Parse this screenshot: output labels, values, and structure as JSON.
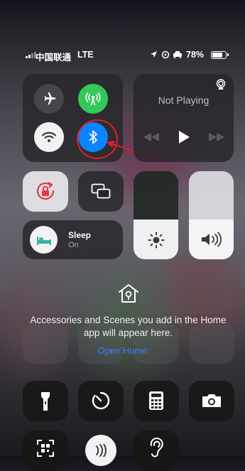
{
  "status_bar": {
    "carrier": "中国联通",
    "network": "LTE",
    "battery": "78%"
  },
  "connectivity": {
    "airplane": {
      "on": false
    },
    "cellular": {
      "on": true
    },
    "wifi": {
      "on": true
    },
    "bluetooth": {
      "on": true
    }
  },
  "media": {
    "title": "Not Playing"
  },
  "focus": {
    "label": "Sleep",
    "state": "On"
  },
  "brightness": {
    "level": 0.45
  },
  "volume": {
    "level": 0.45
  },
  "home": {
    "message": "Accessories and Scenes you add in the Home app will appear here.",
    "link": "Open Home"
  },
  "colors": {
    "cellular_green": "#34c759",
    "bluetooth_blue": "#0a84ff",
    "annotation_red": "#e02020",
    "link_blue": "#3d7bff"
  },
  "icons": [
    "airplane-icon",
    "cellular-icon",
    "wifi-icon",
    "bluetooth-icon",
    "airplay-icon",
    "rewind-icon",
    "play-icon",
    "fast-forward-icon",
    "orientation-lock-icon",
    "screen-mirroring-icon",
    "bed-icon",
    "brightness-icon",
    "volume-icon",
    "home-icon",
    "flashlight-icon",
    "timer-icon",
    "calculator-icon",
    "camera-icon",
    "qr-scanner-icon",
    "nfc-icon",
    "hearing-icon"
  ]
}
